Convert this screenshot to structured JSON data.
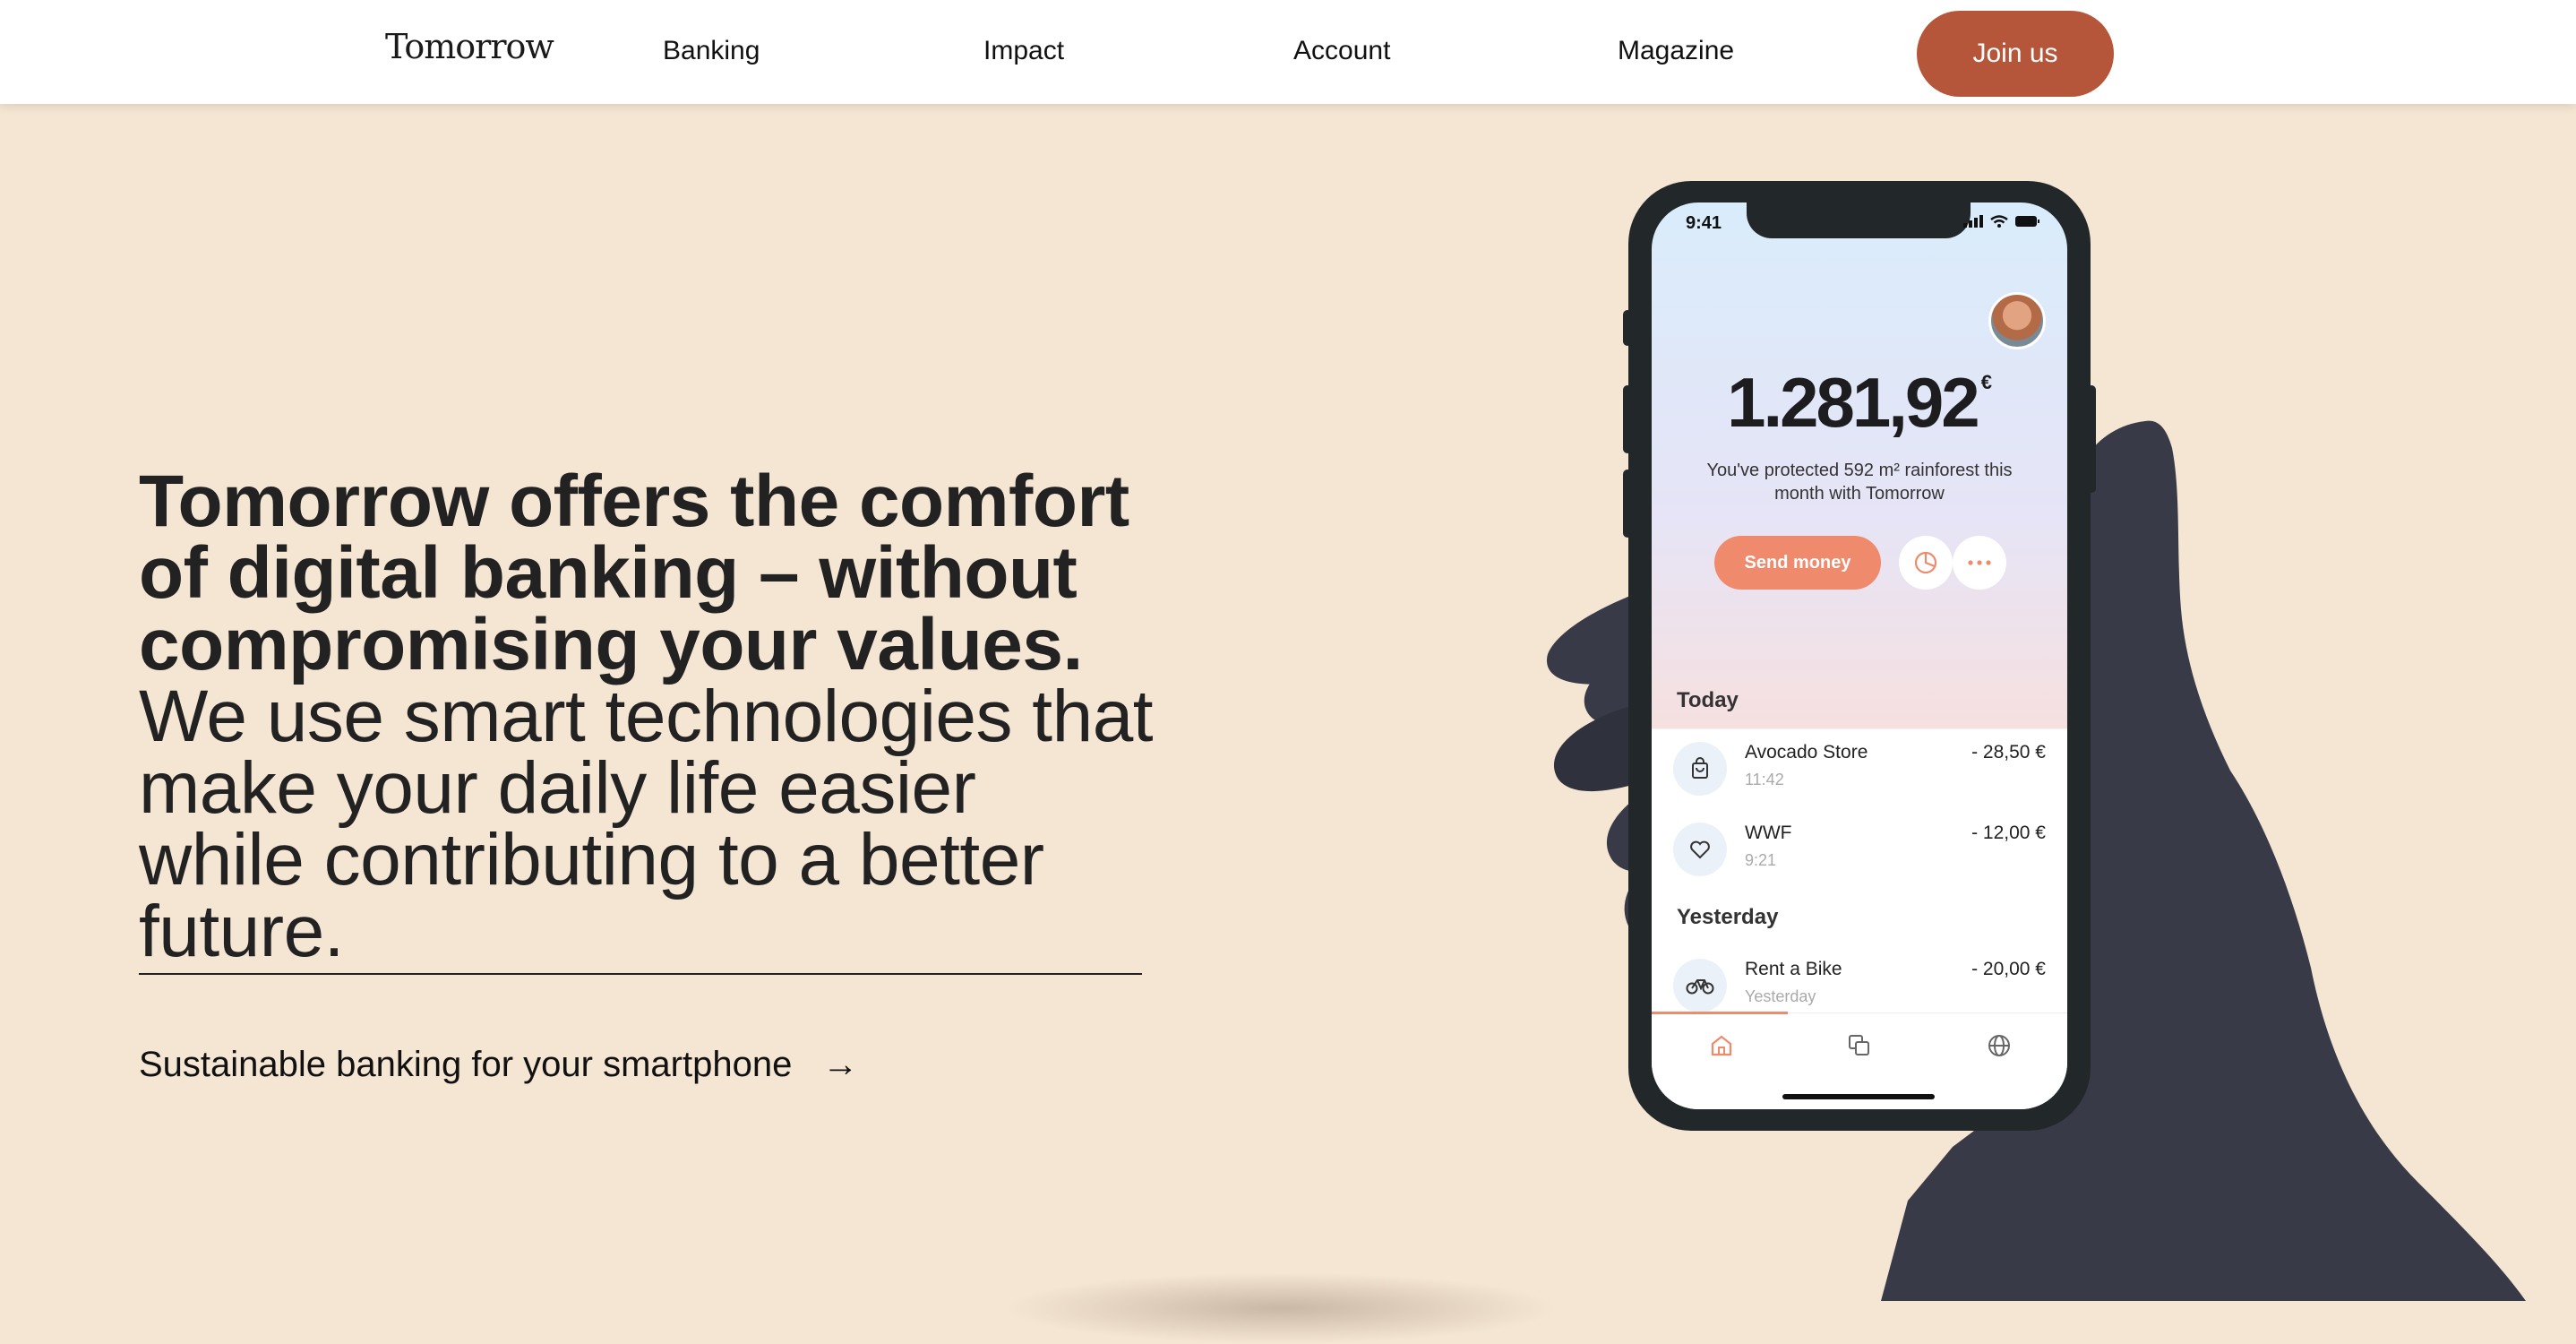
{
  "nav": {
    "logo": "Tomorrow",
    "links": [
      "Banking",
      "Impact",
      "Account",
      "Magazine"
    ],
    "join_label": "Join us"
  },
  "hero": {
    "headline_strong": "Tomorrow offers the comfort of digital banking – without compromising your values.",
    "headline_rest": " We use smart technologies that make your daily life easier while contributing to a better future.",
    "cta_label": "Sustainable banking for your smartphone",
    "cta_arrow": "→"
  },
  "phone": {
    "time": "9:41",
    "balance": "1.281,92",
    "currency": "€",
    "protected_text": "You've protected 592 m² rainforest this month with Tomorrow",
    "send_label": "Send money",
    "today_label": "Today",
    "yesterday_label": "Yesterday",
    "transactions": [
      {
        "name": "Avocado Store",
        "sub": "11:42",
        "amount": "- 28,50 €",
        "icon": "shopping-bag-icon"
      },
      {
        "name": "WWF",
        "sub": "9:21",
        "amount": "- 12,00 €",
        "icon": "heart-icon"
      },
      {
        "name": "Rent a Bike",
        "sub": "Yesterday",
        "amount": "- 20,00 €",
        "icon": "bike-icon"
      }
    ],
    "tabs": [
      "home-icon",
      "cards-icon",
      "globe-icon"
    ]
  },
  "colors": {
    "background": "#f5e5d3",
    "accent": "#b5563a",
    "send_button": "#ef8a6d"
  }
}
